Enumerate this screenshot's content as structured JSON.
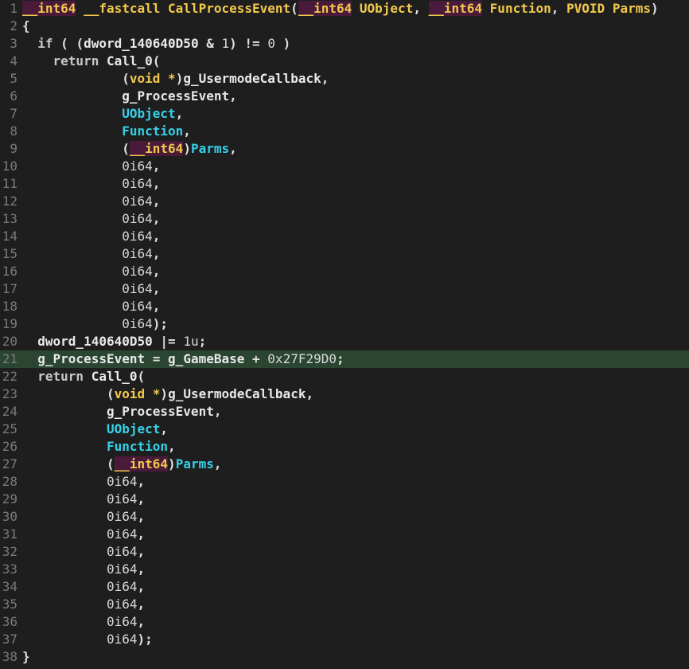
{
  "editor": {
    "highlight_line": 21,
    "lines": [
      {
        "n": "1",
        "tokens": [
          {
            "t": "type",
            "v": "__int64"
          },
          {
            "t": "plain",
            "v": " "
          },
          {
            "t": "cc",
            "v": "__fastcall"
          },
          {
            "t": "plain",
            "v": " "
          },
          {
            "t": "fn",
            "v": "CallProcessEvent"
          },
          {
            "t": "punct",
            "v": "("
          },
          {
            "t": "type",
            "v": "__int64"
          },
          {
            "t": "plain",
            "v": " "
          },
          {
            "t": "var",
            "v": "UObject"
          },
          {
            "t": "punct",
            "v": ", "
          },
          {
            "t": "type",
            "v": "__int64"
          },
          {
            "t": "plain",
            "v": " "
          },
          {
            "t": "var",
            "v": "Function"
          },
          {
            "t": "punct",
            "v": ", "
          },
          {
            "t": "var",
            "v": "PVOID"
          },
          {
            "t": "plain",
            "v": " "
          },
          {
            "t": "var",
            "v": "Parms"
          },
          {
            "t": "punct",
            "v": ")"
          }
        ]
      },
      {
        "n": "2",
        "tokens": [
          {
            "t": "punct",
            "v": "{"
          }
        ]
      },
      {
        "n": "3",
        "tokens": [
          {
            "t": "plain",
            "v": "  "
          },
          {
            "t": "kw",
            "v": "if"
          },
          {
            "t": "plain",
            "v": " "
          },
          {
            "t": "punct",
            "v": "( ("
          },
          {
            "t": "global",
            "v": "dword_140640D50"
          },
          {
            "t": "plain",
            "v": " "
          },
          {
            "t": "op",
            "v": "&"
          },
          {
            "t": "plain",
            "v": " "
          },
          {
            "t": "num",
            "v": "1"
          },
          {
            "t": "punct",
            "v": ")"
          },
          {
            "t": "plain",
            "v": " "
          },
          {
            "t": "op",
            "v": "!="
          },
          {
            "t": "plain",
            "v": " "
          },
          {
            "t": "num",
            "v": "0"
          },
          {
            "t": "plain",
            "v": " "
          },
          {
            "t": "punct",
            "v": ")"
          }
        ]
      },
      {
        "n": "4",
        "tokens": [
          {
            "t": "plain",
            "v": "    "
          },
          {
            "t": "kw",
            "v": "return"
          },
          {
            "t": "plain",
            "v": " "
          },
          {
            "t": "global",
            "v": "Call_0"
          },
          {
            "t": "punct",
            "v": "("
          }
        ]
      },
      {
        "n": "5",
        "tokens": [
          {
            "t": "plain",
            "v": "             "
          },
          {
            "t": "punct",
            "v": "("
          },
          {
            "t": "cc",
            "v": "void"
          },
          {
            "t": "plain",
            "v": " "
          },
          {
            "t": "ptr",
            "v": "*"
          },
          {
            "t": "punct",
            "v": ")"
          },
          {
            "t": "global",
            "v": "g_UsermodeCallback"
          },
          {
            "t": "punct",
            "v": ","
          }
        ]
      },
      {
        "n": "6",
        "tokens": [
          {
            "t": "plain",
            "v": "             "
          },
          {
            "t": "global",
            "v": "g_ProcessEvent"
          },
          {
            "t": "punct",
            "v": ","
          }
        ]
      },
      {
        "n": "7",
        "tokens": [
          {
            "t": "plain",
            "v": "             "
          },
          {
            "t": "param",
            "v": "UObject"
          },
          {
            "t": "punct",
            "v": ","
          }
        ]
      },
      {
        "n": "8",
        "tokens": [
          {
            "t": "plain",
            "v": "             "
          },
          {
            "t": "param",
            "v": "Function"
          },
          {
            "t": "punct",
            "v": ","
          }
        ]
      },
      {
        "n": "9",
        "tokens": [
          {
            "t": "plain",
            "v": "             "
          },
          {
            "t": "punct",
            "v": "("
          },
          {
            "t": "type",
            "v": "__int64"
          },
          {
            "t": "punct",
            "v": ")"
          },
          {
            "t": "param",
            "v": "Parms"
          },
          {
            "t": "punct",
            "v": ","
          }
        ]
      },
      {
        "n": "10",
        "tokens": [
          {
            "t": "plain",
            "v": "             "
          },
          {
            "t": "num",
            "v": "0i64"
          },
          {
            "t": "punct",
            "v": ","
          }
        ]
      },
      {
        "n": "11",
        "tokens": [
          {
            "t": "plain",
            "v": "             "
          },
          {
            "t": "num",
            "v": "0i64"
          },
          {
            "t": "punct",
            "v": ","
          }
        ]
      },
      {
        "n": "12",
        "tokens": [
          {
            "t": "plain",
            "v": "             "
          },
          {
            "t": "num",
            "v": "0i64"
          },
          {
            "t": "punct",
            "v": ","
          }
        ]
      },
      {
        "n": "13",
        "tokens": [
          {
            "t": "plain",
            "v": "             "
          },
          {
            "t": "num",
            "v": "0i64"
          },
          {
            "t": "punct",
            "v": ","
          }
        ]
      },
      {
        "n": "14",
        "tokens": [
          {
            "t": "plain",
            "v": "             "
          },
          {
            "t": "num",
            "v": "0i64"
          },
          {
            "t": "punct",
            "v": ","
          }
        ]
      },
      {
        "n": "15",
        "tokens": [
          {
            "t": "plain",
            "v": "             "
          },
          {
            "t": "num",
            "v": "0i64"
          },
          {
            "t": "punct",
            "v": ","
          }
        ]
      },
      {
        "n": "16",
        "tokens": [
          {
            "t": "plain",
            "v": "             "
          },
          {
            "t": "num",
            "v": "0i64"
          },
          {
            "t": "punct",
            "v": ","
          }
        ]
      },
      {
        "n": "17",
        "tokens": [
          {
            "t": "plain",
            "v": "             "
          },
          {
            "t": "num",
            "v": "0i64"
          },
          {
            "t": "punct",
            "v": ","
          }
        ]
      },
      {
        "n": "18",
        "tokens": [
          {
            "t": "plain",
            "v": "             "
          },
          {
            "t": "num",
            "v": "0i64"
          },
          {
            "t": "punct",
            "v": ","
          }
        ]
      },
      {
        "n": "19",
        "tokens": [
          {
            "t": "plain",
            "v": "             "
          },
          {
            "t": "num",
            "v": "0i64"
          },
          {
            "t": "punct",
            "v": ");"
          }
        ]
      },
      {
        "n": "20",
        "tokens": [
          {
            "t": "plain",
            "v": "  "
          },
          {
            "t": "global",
            "v": "dword_140640D50"
          },
          {
            "t": "plain",
            "v": " "
          },
          {
            "t": "op",
            "v": "|="
          },
          {
            "t": "plain",
            "v": " "
          },
          {
            "t": "num",
            "v": "1u"
          },
          {
            "t": "punct",
            "v": ";"
          }
        ]
      },
      {
        "n": "21",
        "tokens": [
          {
            "t": "plain",
            "v": "  "
          },
          {
            "t": "global",
            "v": "g_ProcessEvent"
          },
          {
            "t": "plain",
            "v": " "
          },
          {
            "t": "op",
            "v": "="
          },
          {
            "t": "plain",
            "v": " "
          },
          {
            "t": "global",
            "v": "g_GameBase"
          },
          {
            "t": "plain",
            "v": " "
          },
          {
            "t": "op",
            "v": "+"
          },
          {
            "t": "plain",
            "v": " "
          },
          {
            "t": "hex",
            "v": "0x27F29D0"
          },
          {
            "t": "punct",
            "v": ";"
          }
        ]
      },
      {
        "n": "22",
        "tokens": [
          {
            "t": "plain",
            "v": "  "
          },
          {
            "t": "kw",
            "v": "return"
          },
          {
            "t": "plain",
            "v": " "
          },
          {
            "t": "global",
            "v": "Call_0"
          },
          {
            "t": "punct",
            "v": "("
          }
        ]
      },
      {
        "n": "23",
        "tokens": [
          {
            "t": "plain",
            "v": "           "
          },
          {
            "t": "punct",
            "v": "("
          },
          {
            "t": "cc",
            "v": "void"
          },
          {
            "t": "plain",
            "v": " "
          },
          {
            "t": "ptr",
            "v": "*"
          },
          {
            "t": "punct",
            "v": ")"
          },
          {
            "t": "global",
            "v": "g_UsermodeCallback"
          },
          {
            "t": "punct",
            "v": ","
          }
        ]
      },
      {
        "n": "24",
        "tokens": [
          {
            "t": "plain",
            "v": "           "
          },
          {
            "t": "global",
            "v": "g_ProcessEvent"
          },
          {
            "t": "punct",
            "v": ","
          }
        ]
      },
      {
        "n": "25",
        "tokens": [
          {
            "t": "plain",
            "v": "           "
          },
          {
            "t": "param",
            "v": "UObject"
          },
          {
            "t": "punct",
            "v": ","
          }
        ]
      },
      {
        "n": "26",
        "tokens": [
          {
            "t": "plain",
            "v": "           "
          },
          {
            "t": "param",
            "v": "Function"
          },
          {
            "t": "punct",
            "v": ","
          }
        ]
      },
      {
        "n": "27",
        "tokens": [
          {
            "t": "plain",
            "v": "           "
          },
          {
            "t": "punct",
            "v": "("
          },
          {
            "t": "type",
            "v": "__int64"
          },
          {
            "t": "punct",
            "v": ")"
          },
          {
            "t": "param",
            "v": "Parms"
          },
          {
            "t": "punct",
            "v": ","
          }
        ]
      },
      {
        "n": "28",
        "tokens": [
          {
            "t": "plain",
            "v": "           "
          },
          {
            "t": "num",
            "v": "0i64"
          },
          {
            "t": "punct",
            "v": ","
          }
        ]
      },
      {
        "n": "29",
        "tokens": [
          {
            "t": "plain",
            "v": "           "
          },
          {
            "t": "num",
            "v": "0i64"
          },
          {
            "t": "punct",
            "v": ","
          }
        ]
      },
      {
        "n": "30",
        "tokens": [
          {
            "t": "plain",
            "v": "           "
          },
          {
            "t": "num",
            "v": "0i64"
          },
          {
            "t": "punct",
            "v": ","
          }
        ]
      },
      {
        "n": "31",
        "tokens": [
          {
            "t": "plain",
            "v": "           "
          },
          {
            "t": "num",
            "v": "0i64"
          },
          {
            "t": "punct",
            "v": ","
          }
        ]
      },
      {
        "n": "32",
        "tokens": [
          {
            "t": "plain",
            "v": "           "
          },
          {
            "t": "num",
            "v": "0i64"
          },
          {
            "t": "punct",
            "v": ","
          }
        ]
      },
      {
        "n": "33",
        "tokens": [
          {
            "t": "plain",
            "v": "           "
          },
          {
            "t": "num",
            "v": "0i64"
          },
          {
            "t": "punct",
            "v": ","
          }
        ]
      },
      {
        "n": "34",
        "tokens": [
          {
            "t": "plain",
            "v": "           "
          },
          {
            "t": "num",
            "v": "0i64"
          },
          {
            "t": "punct",
            "v": ","
          }
        ]
      },
      {
        "n": "35",
        "tokens": [
          {
            "t": "plain",
            "v": "           "
          },
          {
            "t": "num",
            "v": "0i64"
          },
          {
            "t": "punct",
            "v": ","
          }
        ]
      },
      {
        "n": "36",
        "tokens": [
          {
            "t": "plain",
            "v": "           "
          },
          {
            "t": "num",
            "v": "0i64"
          },
          {
            "t": "punct",
            "v": ","
          }
        ]
      },
      {
        "n": "37",
        "tokens": [
          {
            "t": "plain",
            "v": "           "
          },
          {
            "t": "num",
            "v": "0i64"
          },
          {
            "t": "punct",
            "v": ");"
          }
        ]
      },
      {
        "n": "38",
        "tokens": [
          {
            "t": "punct",
            "v": "}"
          }
        ]
      }
    ]
  },
  "colors": {
    "background": "#1e1e1e",
    "highlight_line_bg": "#2a4531",
    "type_fg": "#f2c94c",
    "type_bg": "#4a1a3a",
    "param_fg": "#35d0e8",
    "line_number_fg": "#7a7a7a"
  }
}
